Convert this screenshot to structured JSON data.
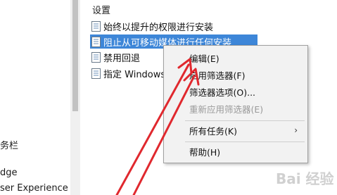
{
  "left_tree": {
    "items": [
      {
        "label": "务栏"
      },
      {
        "label": "dge"
      },
      {
        "label": "ser Experience V"
      }
    ]
  },
  "list": {
    "header": "设置",
    "rows": [
      {
        "label": "始终以提升的权限进行安装"
      },
      {
        "label": "阻止从可移动媒体进行任何安装"
      },
      {
        "label": "禁用回退"
      },
      {
        "label": "指定 Windows"
      }
    ]
  },
  "context_menu": {
    "items": [
      {
        "label": "编辑(E)"
      },
      {
        "label": "启用筛选器(F)"
      },
      {
        "label": "筛选器选项(O)..."
      },
      {
        "label": "重新应用筛选器(E)"
      },
      {
        "label": "所有任务(K)"
      },
      {
        "label": "帮助(H)"
      }
    ],
    "submenu_arrow": "›"
  },
  "watermark": {
    "text": "Bai 经验"
  },
  "colors": {
    "selection": "#3d86d8",
    "arrow": "#e0282e",
    "menu_bg": "#f2f2f2"
  },
  "icons": {
    "policy": "policy-setting-icon"
  }
}
